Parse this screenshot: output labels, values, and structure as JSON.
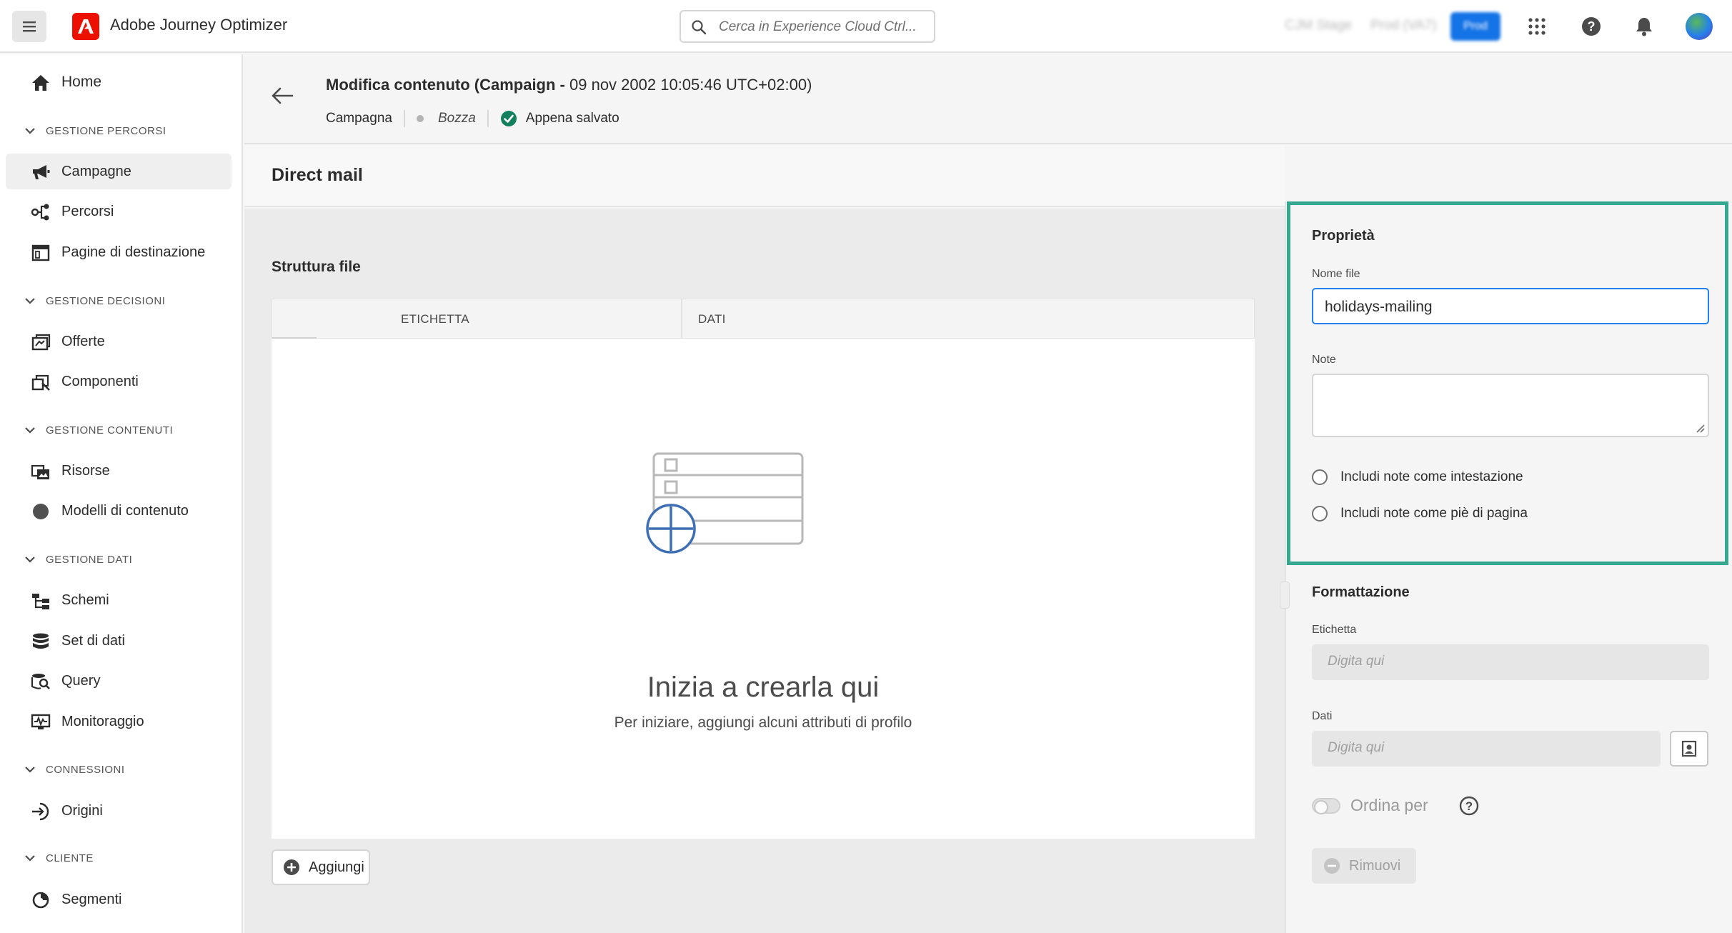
{
  "topbar": {
    "app_title": "Adobe Journey Optimizer",
    "search_placeholder": "Cerca in Experience Cloud Ctrl...",
    "org_label": "CJM Stage",
    "sandbox_label": "Prod (VA7)",
    "env_button": "Prod"
  },
  "sidebar": {
    "home": "Home",
    "sections": [
      {
        "label": "GESTIONE PERCORSI",
        "items": [
          "Campagne",
          "Percorsi",
          "Pagine di destinazione"
        ]
      },
      {
        "label": "GESTIONE DECISIONI",
        "items": [
          "Offerte",
          "Componenti"
        ]
      },
      {
        "label": "GESTIONE CONTENUTI",
        "items": [
          "Risorse",
          "Modelli di contenuto"
        ]
      },
      {
        "label": "GESTIONE DATI",
        "items": [
          "Schemi",
          "Set di dati",
          "Query",
          "Monitoraggio"
        ]
      },
      {
        "label": "CONNESSIONI",
        "items": [
          "Origini"
        ]
      },
      {
        "label": "CLIENTE",
        "items": [
          "Segmenti"
        ]
      }
    ],
    "active_item": "Campagne"
  },
  "header": {
    "title_bold": "Modifica contenuto (Campaign - ",
    "title_rest": "09 nov 2002 10:05:46 UTC+02:00)",
    "breadcrumb_type": "Campagna",
    "status": "Bozza",
    "save_status": "Appena salvato"
  },
  "channel": {
    "title": "Direct mail"
  },
  "structure": {
    "title": "Struttura file",
    "columns": [
      "ETICHETTA",
      "DATI"
    ],
    "empty_title": "Inizia a crearla qui",
    "empty_subtitle": "Per iniziare, aggiungi alcuni attributi di profilo",
    "add_label": "Aggiungi"
  },
  "properties": {
    "title": "Proprietà",
    "filename_label": "Nome file",
    "filename_value": "holidays-mailing",
    "notes_label": "Note",
    "notes_value": "",
    "radio_header": "Includi note come intestazione",
    "radio_footer": "Includi note come piè di pagina"
  },
  "formatting": {
    "title": "Formattazione",
    "label_label": "Etichetta",
    "label_placeholder": "Digita qui",
    "data_label": "Dati",
    "data_placeholder": "Digita qui",
    "sort_label": "Ordina per",
    "remove_label": "Rimuovi"
  },
  "colors": {
    "accent_blue": "#2680eb",
    "adobe_red": "#eb1000",
    "highlight_green": "#36a88f",
    "saved_green": "#12805c"
  }
}
